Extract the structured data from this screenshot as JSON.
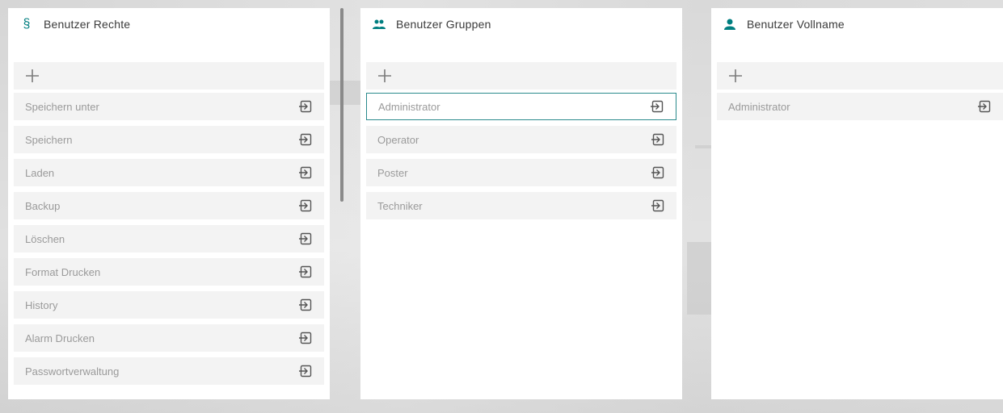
{
  "colors": {
    "accent": "#007e80",
    "item_bg": "#f3f3f3",
    "text": "#9a9a9a"
  },
  "panels": [
    {
      "title": "Benutzer Rechte",
      "icon": "section-sign-icon",
      "icon_glyph": "§",
      "add_label": "+",
      "items": [
        "Speichern unter",
        "Speichern",
        "Laden",
        "Backup",
        "Löschen",
        "Format Drucken",
        "History",
        "Alarm Drucken",
        "Passwortverwaltung"
      ]
    },
    {
      "title": "Benutzer Gruppen",
      "icon": "user-group-icon",
      "add_label": "+",
      "items": [
        "Administrator",
        "Operator",
        "Poster",
        "Techniker"
      ],
      "selected_index": 0
    },
    {
      "title": "Benutzer Vollname",
      "icon": "user-icon",
      "add_label": "+",
      "items": [
        "Administrator"
      ]
    }
  ]
}
